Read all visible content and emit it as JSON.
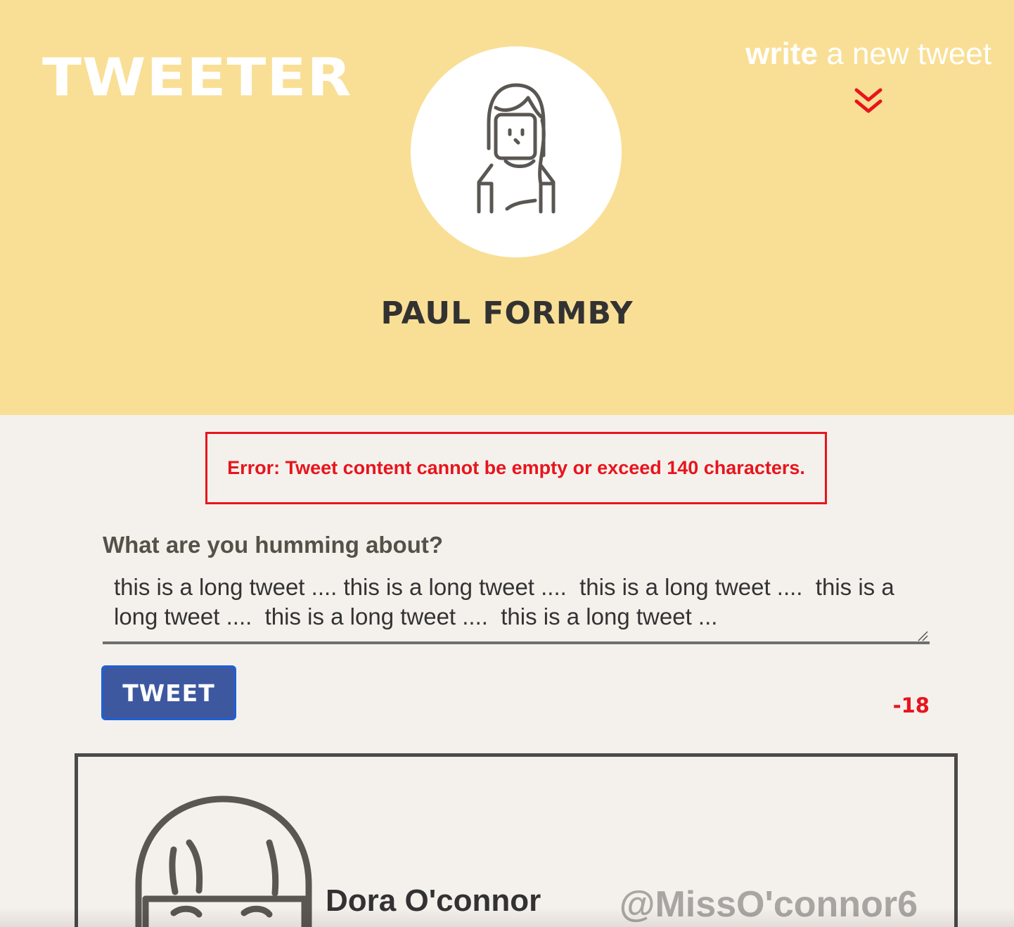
{
  "header": {
    "logo": "TWEETER",
    "write_link": {
      "strong": "write",
      "rest": " a new tweet"
    },
    "chevron_icon": "double-chevron-down-icon",
    "avatar_icon": "woman-avatar-icon",
    "profile_name": "PAUL FORMBY",
    "bg_color": "#f9df95",
    "accent_color": "#e8141d"
  },
  "error": {
    "message": "Error: Tweet content cannot be empty or exceed 140 characters."
  },
  "compose": {
    "label": "What are you humming about?",
    "value": "this is a long tweet .... this is a long tweet ....  this is a long tweet ....  this is a long tweet ....  this is a long tweet ....  this is a long tweet ...",
    "button_label": "TWEET",
    "counter": "-18",
    "button_color": "#3e58a0"
  },
  "tweets": [
    {
      "name": "Dora O'connor",
      "handle": "@MissO'connor6",
      "avatar_icon": "woman-avatar-icon"
    }
  ]
}
